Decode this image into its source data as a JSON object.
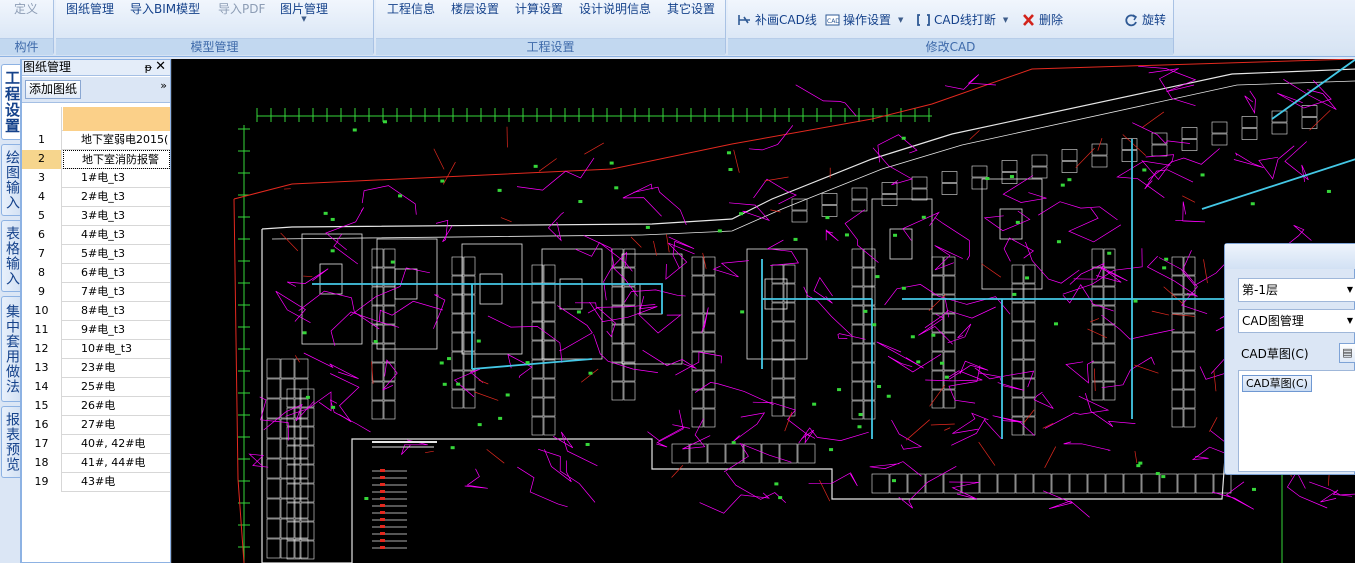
{
  "ribbon": {
    "groups": [
      {
        "caption": "构件",
        "buttons": [
          "定义"
        ]
      },
      {
        "caption": "模型管理",
        "buttons": [
          "图纸管理",
          "导入BIM模型",
          "导入PDF",
          "图片管理"
        ]
      },
      {
        "caption": "工程设置",
        "buttons": [
          "工程信息",
          "楼层设置",
          "计算设置",
          "设计说明信息",
          "其它设置"
        ]
      },
      {
        "caption": "修改CAD",
        "buttons": [
          "补画CAD线",
          "操作设置",
          "CAD线打断",
          "删除",
          "旋转"
        ]
      }
    ],
    "disabled": [
      "定义",
      "导入PDF"
    ]
  },
  "vtabs": [
    "工程设置",
    "绘图输入",
    "表格输入",
    "集中套用做法",
    "报表预览"
  ],
  "panel": {
    "title": "图纸管理",
    "add_button": "添加图纸",
    "rows": [
      {
        "num": "1",
        "name": "地下室弱电2015("
      },
      {
        "num": "2",
        "name": "地下室消防报警"
      },
      {
        "num": "3",
        "name": "1#电_t3"
      },
      {
        "num": "4",
        "name": "2#电_t3"
      },
      {
        "num": "5",
        "name": "3#电_t3"
      },
      {
        "num": "6",
        "name": "4#电_t3"
      },
      {
        "num": "7",
        "name": "5#电_t3"
      },
      {
        "num": "8",
        "name": "6#电_t3"
      },
      {
        "num": "9",
        "name": "7#电_t3"
      },
      {
        "num": "10",
        "name": "8#电_t3"
      },
      {
        "num": "11",
        "name": "9#电_t3"
      },
      {
        "num": "12",
        "name": "10#电_t3"
      },
      {
        "num": "13",
        "name": "23#电"
      },
      {
        "num": "14",
        "name": "25#电"
      },
      {
        "num": "15",
        "name": "26#电"
      },
      {
        "num": "16",
        "name": "27#电"
      },
      {
        "num": "17",
        "name": "40#, 42#电"
      },
      {
        "num": "18",
        "name": "41#, 44#电"
      },
      {
        "num": "19",
        "name": "43#电"
      }
    ],
    "selected_row": "2"
  },
  "dialog": {
    "floor": "第-1层",
    "mode": "CAD图管理",
    "label": "CAD草图(C)",
    "chip": "CAD草图(C)"
  },
  "colors": {
    "canvas": "#000000",
    "magenta": "#ff00ff",
    "cyan": "#44c8e6",
    "white": "#e6e6e6",
    "red": "#e3291f",
    "green": "#36d63a"
  }
}
